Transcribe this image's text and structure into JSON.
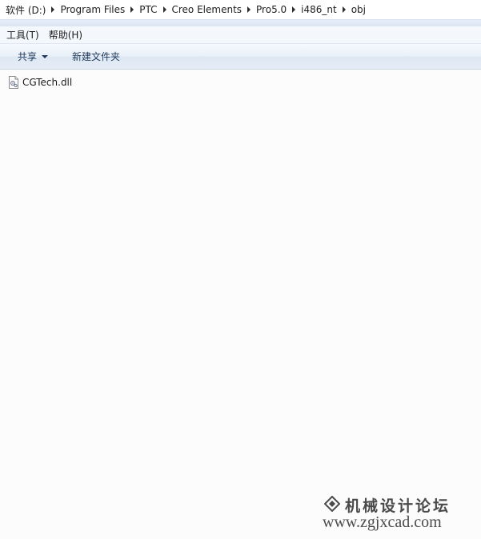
{
  "breadcrumb": {
    "items": [
      "软件 (D:)",
      "Program Files",
      "PTC",
      "Creo Elements",
      "Pro5.0",
      "i486_nt",
      "obj"
    ]
  },
  "menu": {
    "items": [
      "工具(T)",
      "帮助(H)"
    ]
  },
  "toolbar": {
    "share_label": "共享",
    "new_folder_label": "新建文件夹"
  },
  "files": [
    {
      "name": "CGTech.dll",
      "icon": "dll-file-icon"
    }
  ],
  "watermark": {
    "title": "机械设计论坛",
    "url": "www.zgjxcad.com"
  },
  "colors": {
    "toolbar_text": "#1e395b",
    "background": "#fcfcfd",
    "watermark": "#4a4a4a"
  }
}
